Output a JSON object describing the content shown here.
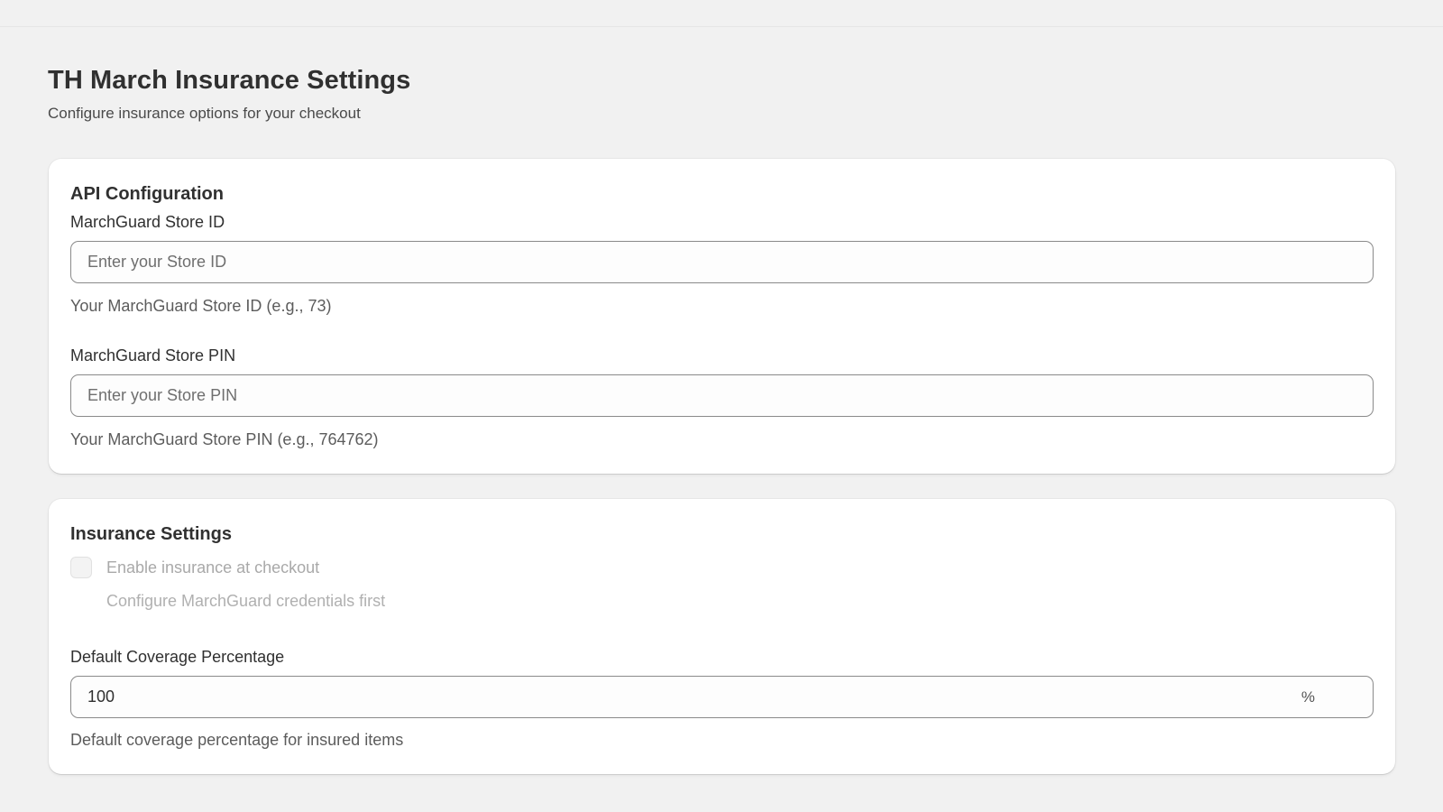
{
  "page": {
    "title": "TH March Insurance Settings",
    "subtitle": "Configure insurance options for your checkout"
  },
  "api_config": {
    "heading": "API Configuration",
    "store_id": {
      "label": "MarchGuard Store ID",
      "placeholder": "Enter your Store ID",
      "value": "",
      "help": "Your MarchGuard Store ID (e.g., 73)"
    },
    "store_pin": {
      "label": "MarchGuard Store PIN",
      "placeholder": "Enter your Store PIN",
      "value": "",
      "help": "Your MarchGuard Store PIN (e.g., 764762)"
    }
  },
  "insurance_settings": {
    "heading": "Insurance Settings",
    "enable_checkbox": {
      "label": "Enable insurance at checkout",
      "checked": false,
      "disabled": true,
      "help": "Configure MarchGuard credentials first"
    },
    "coverage": {
      "label": "Default Coverage Percentage",
      "value": "100",
      "suffix": "%",
      "help": "Default coverage percentage for insured items"
    }
  },
  "colors": {
    "background": "#f1f1f1",
    "card": "#ffffff",
    "text": "#303030",
    "input_border": "#8a8a8a",
    "disabled_text": "#a9a9a9"
  }
}
